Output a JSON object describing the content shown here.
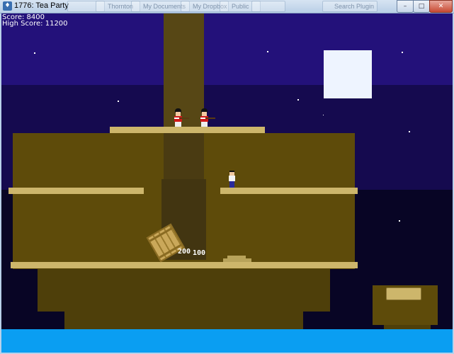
{
  "window": {
    "title": "1776: Tea Party",
    "taskbar_ghost_items": [
      "",
      "Thornton",
      "My Documents",
      "My Dropbox",
      "Public",
      "",
      "Search Plugin"
    ],
    "controls": {
      "minimize": "–",
      "maximize": "□",
      "close": "✕"
    }
  },
  "hud": {
    "score_label": "Score: 8400",
    "high_score_label": "High Score: 11200"
  },
  "game": {
    "floating_points": [
      "200",
      "100"
    ],
    "colors": {
      "sky_top": "#23117a",
      "sky_mid": "#150a4f",
      "sky_low": "#080525",
      "hull": "#5e4b0a",
      "deck_plank": "#cdb66b",
      "water": "#0a9ef2",
      "moon": "#eef4ff",
      "redcoat": "#d01818"
    },
    "sprites": {
      "player": "colonist-player",
      "enemies": [
        "redcoat-soldier",
        "redcoat-soldier"
      ],
      "crate": "tea-crate",
      "chest": "tea-chest-on-dock"
    }
  }
}
